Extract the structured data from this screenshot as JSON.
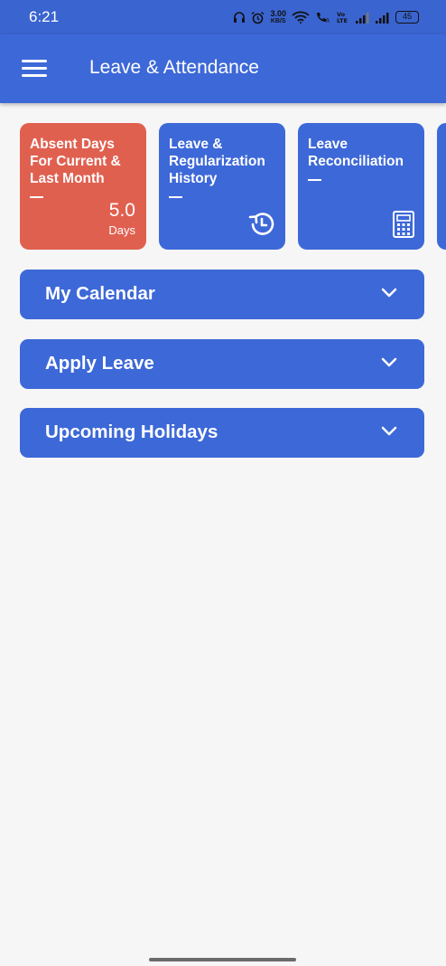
{
  "status_bar": {
    "time": "6:21",
    "speed_value": "3.00",
    "speed_unit": "KB/S",
    "volte": "Vo\nLTE",
    "battery": "45"
  },
  "app_bar": {
    "title": "Leave & Attendance",
    "menu_icon": "hamburger-menu-icon"
  },
  "cards": [
    {
      "title": "Absent Days For Current & Last Month",
      "value": "5.0",
      "unit": "Days",
      "color": "#e06050"
    },
    {
      "title": "Leave & Regularization History",
      "icon": "history-icon",
      "color": "#3d68d8"
    },
    {
      "title": "Leave Reconciliation",
      "icon": "calculator-icon",
      "color": "#3d68d8"
    }
  ],
  "sections": [
    {
      "label": "My Calendar"
    },
    {
      "label": "Apply Leave"
    },
    {
      "label": "Upcoming Holidays"
    }
  ],
  "colors": {
    "primary": "#3d68d8",
    "status_bar": "#3a64cf",
    "absent_card": "#e06050",
    "background": "#f6f6f6"
  }
}
